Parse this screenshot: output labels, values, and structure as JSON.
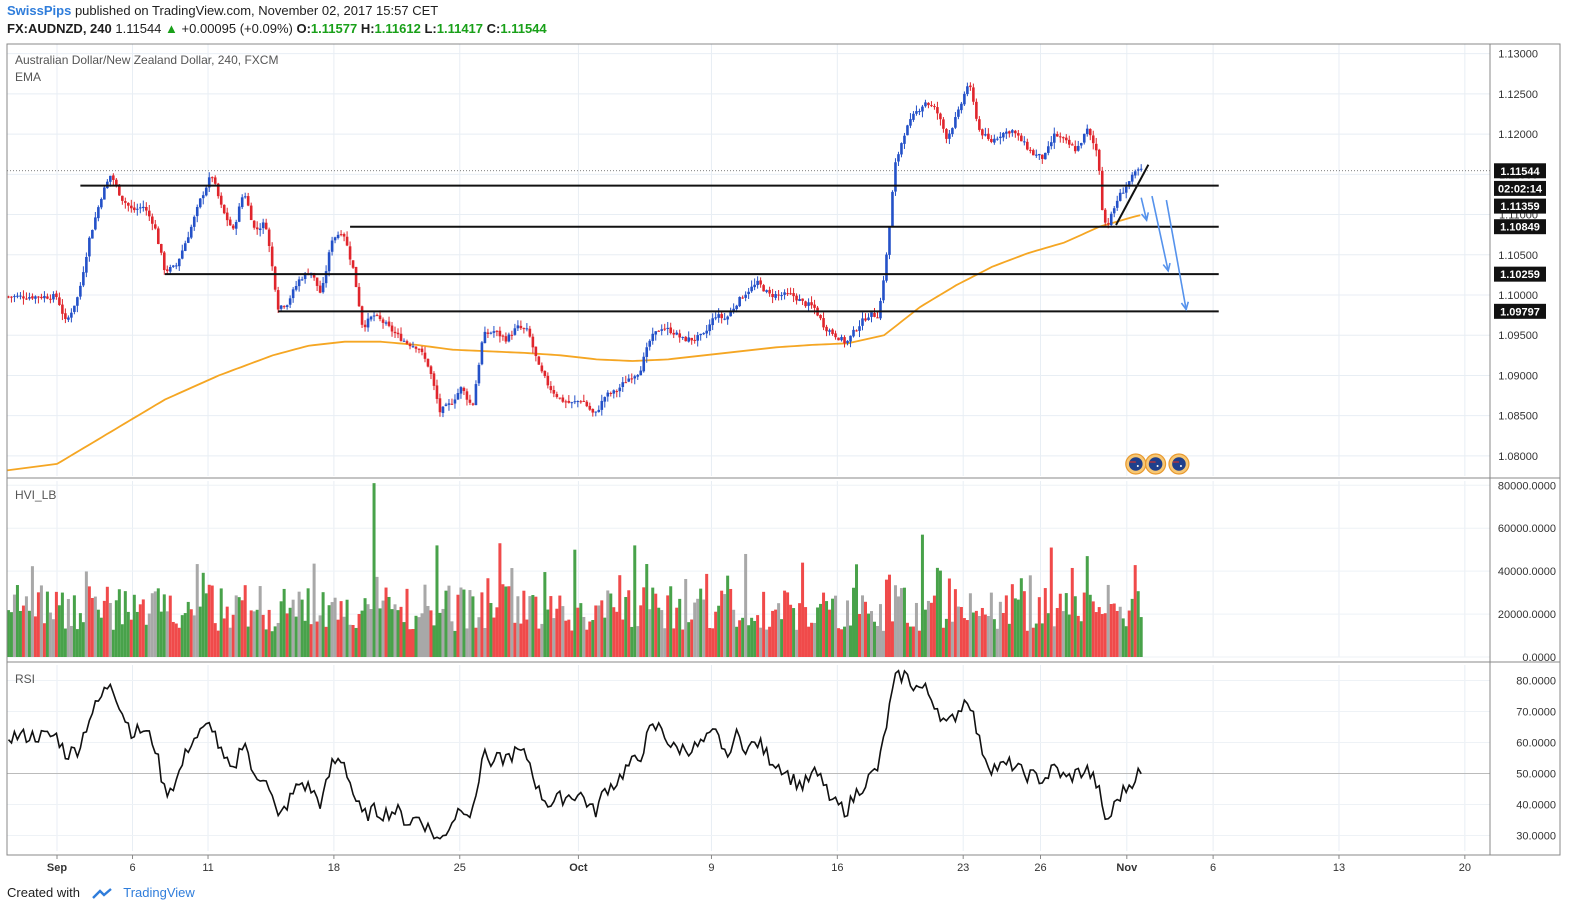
{
  "header": {
    "author": "SwissPips",
    "published": "published on TradingView.com, November 02, 2017 15:57 CET",
    "symbol": "FX:AUDNZD, 240",
    "last": "1.11544",
    "change": "+0.00095 (+0.09%)",
    "o_label": "O:",
    "o_value": "1.11577",
    "h_label": "H:",
    "h_value": "1.11612",
    "l_label": "L:",
    "l_value": "1.11417",
    "c_label": "C:",
    "c_value": "1.11544"
  },
  "footer": {
    "created": "Created with",
    "brand": "TradingView"
  },
  "colors": {
    "up": "#2451c8",
    "down": "#e0252c",
    "ema": "#f5a623",
    "vol_up": "#48a24a",
    "vol_down": "#f04a4a",
    "vol_neutral": "#a8a8a8",
    "arrow": "#5592ec"
  },
  "chart_data": [
    {
      "type": "candlestick",
      "title": "Australian Dollar/New Zealand Dollar, 240, FXCM",
      "subtitle": "EMA",
      "x_ticks": [
        "Sep",
        "6",
        "11",
        "18",
        "25",
        "Oct",
        "9",
        "16",
        "23",
        "26",
        "Nov",
        "6",
        "13",
        "20"
      ],
      "ylim": [
        1.0775,
        1.1312
      ],
      "y_ticks": [
        "1.13000",
        "1.12500",
        "1.12000",
        "1.11500",
        "1.11000",
        "1.10500",
        "1.10000",
        "1.09500",
        "1.09000",
        "1.08500",
        "1.08000"
      ],
      "price_labels": [
        {
          "text": "1.11544",
          "value": 1.11544
        },
        {
          "text": "02:02:14",
          "value": 1.11325
        },
        {
          "text": "1.11359",
          "value": 1.11105
        },
        {
          "text": "1.10849",
          "value": 1.10849
        },
        {
          "text": "1.10259",
          "value": 1.10259
        },
        {
          "text": "1.09797",
          "value": 1.09797
        }
      ],
      "horizontal_levels": [
        {
          "value": 1.11359,
          "from_day": 1.3,
          "to_day": 63.5
        },
        {
          "value": 1.10849,
          "from_day": 16.3,
          "to_day": 63.5
        },
        {
          "value": 1.10259,
          "from_day": 6.0,
          "to_day": 63.5
        },
        {
          "value": 1.09797,
          "from_day": 12.3,
          "to_day": 63.5
        }
      ],
      "close_path": [
        [
          0.0,
          1.0998
        ],
        [
          0.5,
          1.0965
        ],
        [
          1.2,
          1.1
        ],
        [
          1.8,
          1.107
        ],
        [
          2.5,
          1.1125
        ],
        [
          3.0,
          1.115
        ],
        [
          3.6,
          1.112
        ],
        [
          4.2,
          1.1105
        ],
        [
          4.8,
          1.111
        ],
        [
          5.4,
          1.1088
        ],
        [
          6.0,
          1.103
        ],
        [
          6.6,
          1.1035
        ],
        [
          7.4,
          1.108
        ],
        [
          8.0,
          1.112
        ],
        [
          8.6,
          1.115
        ],
        [
          9.2,
          1.1105
        ],
        [
          9.8,
          1.108
        ],
        [
          10.4,
          1.113
        ],
        [
          11.0,
          1.108
        ],
        [
          11.6,
          1.109
        ],
        [
          12.3,
          1.0985
        ],
        [
          12.8,
          1.099
        ],
        [
          13.5,
          1.102
        ],
        [
          14.1,
          1.103
        ],
        [
          14.7,
          1.1
        ],
        [
          15.3,
          1.107
        ],
        [
          15.9,
          1.108
        ],
        [
          16.5,
          1.103
        ],
        [
          17.0,
          1.096
        ],
        [
          17.6,
          1.0975
        ],
        [
          18.2,
          1.0965
        ],
        [
          18.9,
          1.095
        ],
        [
          19.5,
          1.094
        ],
        [
          20.1,
          1.0935
        ],
        [
          20.7,
          1.091
        ],
        [
          21.3,
          1.0855
        ],
        [
          21.9,
          1.0865
        ],
        [
          22.5,
          1.0885
        ],
        [
          23.1,
          1.086
        ],
        [
          23.7,
          1.095
        ],
        [
          24.3,
          1.0955
        ],
        [
          25.0,
          1.0945
        ],
        [
          25.6,
          1.096
        ],
        [
          26.2,
          1.0955
        ],
        [
          26.8,
          1.091
        ],
        [
          27.4,
          1.0885
        ],
        [
          28.0,
          1.087
        ],
        [
          28.6,
          1.0865
        ],
        [
          29.2,
          1.087
        ],
        [
          29.9,
          1.085
        ],
        [
          30.5,
          1.0875
        ],
        [
          31.1,
          1.088
        ],
        [
          31.7,
          1.0895
        ],
        [
          32.4,
          1.0905
        ],
        [
          33.0,
          1.0945
        ],
        [
          33.6,
          1.096
        ],
        [
          34.2,
          1.0955
        ],
        [
          34.8,
          1.0945
        ],
        [
          35.4,
          1.0945
        ],
        [
          36.0,
          1.095
        ],
        [
          36.6,
          1.0975
        ],
        [
          37.2,
          1.097
        ],
        [
          37.8,
          1.099
        ],
        [
          38.4,
          1.1005
        ],
        [
          39.0,
          1.1015
        ],
        [
          39.6,
          1.1
        ],
        [
          40.3,
          1.1
        ],
        [
          40.9,
          1.1
        ],
        [
          41.5,
          1.099
        ],
        [
          42.1,
          1.0985
        ],
        [
          42.7,
          1.096
        ],
        [
          43.3,
          1.095
        ],
        [
          43.9,
          1.094
        ],
        [
          44.5,
          1.096
        ],
        [
          45.1,
          1.0975
        ],
        [
          45.7,
          1.0975
        ],
        [
          46.2,
          1.106
        ],
        [
          46.6,
          1.116
        ],
        [
          47.1,
          1.12
        ],
        [
          47.7,
          1.1225
        ],
        [
          48.3,
          1.124
        ],
        [
          48.9,
          1.123
        ],
        [
          49.5,
          1.1195
        ],
        [
          50.1,
          1.1225
        ],
        [
          50.7,
          1.1265
        ],
        [
          51.3,
          1.1205
        ],
        [
          51.9,
          1.119
        ],
        [
          52.5,
          1.12
        ],
        [
          53.1,
          1.1205
        ],
        [
          53.7,
          1.119
        ],
        [
          54.3,
          1.1175
        ],
        [
          54.9,
          1.117
        ],
        [
          55.5,
          1.12
        ],
        [
          56.1,
          1.119
        ],
        [
          56.7,
          1.118
        ],
        [
          57.3,
          1.1205
        ],
        [
          57.9,
          1.1175
        ],
        [
          58.2,
          1.109
        ],
        [
          58.5,
          1.109
        ],
        [
          59.0,
          1.112
        ],
        [
          59.6,
          1.114
        ],
        [
          60.1,
          1.1155
        ],
        [
          60.4,
          1.1154
        ]
      ],
      "ema_path": [
        [
          0.0,
          1.079
        ],
        [
          3.0,
          1.083
        ],
        [
          6.0,
          1.087
        ],
        [
          9.0,
          1.09
        ],
        [
          12.0,
          1.0925
        ],
        [
          14.0,
          1.0937
        ],
        [
          16.0,
          1.0942
        ],
        [
          18.0,
          1.0942
        ],
        [
          20.0,
          1.0938
        ],
        [
          22.0,
          1.0932
        ],
        [
          24.0,
          1.093
        ],
        [
          26.0,
          1.0928
        ],
        [
          28.0,
          1.0925
        ],
        [
          30.0,
          1.092
        ],
        [
          32.0,
          1.0918
        ],
        [
          34.0,
          1.092
        ],
        [
          36.0,
          1.0925
        ],
        [
          38.0,
          1.093
        ],
        [
          40.0,
          1.0935
        ],
        [
          42.0,
          1.0938
        ],
        [
          44.0,
          1.094
        ],
        [
          46.0,
          1.095
        ],
        [
          48.0,
          1.0985
        ],
        [
          50.0,
          1.1012
        ],
        [
          52.0,
          1.1035
        ],
        [
          54.0,
          1.1052
        ],
        [
          56.0,
          1.1065
        ],
        [
          58.0,
          1.1085
        ],
        [
          60.0,
          1.1098
        ],
        [
          60.4,
          1.11
        ]
      ],
      "dotted_last_price": 1.11544,
      "forecast_arrows": [
        [
          [
            60.3,
            1.1121
          ],
          [
            60.6,
            1.1093
          ]
        ],
        [
          [
            60.9,
            1.1123
          ],
          [
            61.8,
            1.103
          ]
        ],
        [
          [
            61.7,
            1.1118
          ],
          [
            62.8,
            1.0982
          ]
        ]
      ],
      "trendline": [
        [
          58.9,
          1.1087
        ],
        [
          60.7,
          1.1162
        ]
      ],
      "event_markers": [
        {
          "day": 60.0
        },
        {
          "day": 61.1
        },
        {
          "day": 62.4
        }
      ]
    },
    {
      "type": "bar",
      "title": "HVI_LB",
      "ylim": [
        0,
        82000
      ],
      "y_ticks": [
        "80000.0000",
        "60000.0000",
        "40000.0000",
        "20000.0000",
        "0.0000"
      ],
      "spikes": [
        {
          "day": 17.7,
          "value": 81000
        },
        {
          "day": 21.2,
          "value": 52000
        },
        {
          "day": 24.6,
          "value": 53000
        },
        {
          "day": 28.9,
          "value": 50000
        },
        {
          "day": 32.2,
          "value": 52000
        },
        {
          "day": 38.3,
          "value": 48000
        },
        {
          "day": 48.2,
          "value": 57000
        },
        {
          "day": 55.4,
          "value": 51000
        },
        {
          "day": 57.3,
          "value": 47000
        }
      ]
    },
    {
      "type": "line",
      "title": "RSI",
      "ylim": [
        25,
        85
      ],
      "y_ticks": [
        "80.0000",
        "70.0000",
        "60.0000",
        "50.0000",
        "40.0000",
        "30.0000"
      ],
      "reference_line": 50,
      "values_path": [
        [
          0.0,
          62
        ],
        [
          0.5,
          56
        ],
        [
          1.2,
          58
        ],
        [
          1.8,
          68
        ],
        [
          2.5,
          75
        ],
        [
          3.0,
          80
        ],
        [
          3.6,
          70
        ],
        [
          4.2,
          63
        ],
        [
          4.8,
          64
        ],
        [
          5.4,
          60
        ],
        [
          6.0,
          44
        ],
        [
          6.6,
          47
        ],
        [
          7.4,
          60
        ],
        [
          8.0,
          63
        ],
        [
          8.6,
          66
        ],
        [
          9.2,
          55
        ],
        [
          9.8,
          50
        ],
        [
          10.4,
          62
        ],
        [
          11.0,
          47
        ],
        [
          11.6,
          50
        ],
        [
          12.3,
          35
        ],
        [
          12.8,
          40
        ],
        [
          13.5,
          47
        ],
        [
          14.1,
          45
        ],
        [
          14.7,
          40
        ],
        [
          15.3,
          53
        ],
        [
          15.9,
          55
        ],
        [
          16.5,
          43
        ],
        [
          17.0,
          36
        ],
        [
          17.6,
          38
        ],
        [
          18.2,
          37
        ],
        [
          18.9,
          38
        ],
        [
          19.5,
          34
        ],
        [
          20.1,
          36
        ],
        [
          20.7,
          32
        ],
        [
          21.3,
          28
        ],
        [
          21.9,
          34
        ],
        [
          22.5,
          40
        ],
        [
          23.1,
          36
        ],
        [
          23.7,
          57
        ],
        [
          24.3,
          54
        ],
        [
          25.0,
          55
        ],
        [
          25.6,
          57
        ],
        [
          26.2,
          55
        ],
        [
          26.8,
          44
        ],
        [
          27.4,
          40
        ],
        [
          28.0,
          42
        ],
        [
          28.6,
          43
        ],
        [
          29.2,
          43
        ],
        [
          29.9,
          37
        ],
        [
          30.5,
          45
        ],
        [
          31.1,
          47
        ],
        [
          31.7,
          52
        ],
        [
          32.4,
          55
        ],
        [
          33.0,
          64
        ],
        [
          33.6,
          65
        ],
        [
          34.2,
          58
        ],
        [
          34.8,
          58
        ],
        [
          35.4,
          58
        ],
        [
          36.0,
          60
        ],
        [
          36.6,
          63
        ],
        [
          37.2,
          57
        ],
        [
          37.8,
          62
        ],
        [
          38.4,
          58
        ],
        [
          39.0,
          60
        ],
        [
          39.6,
          55
        ],
        [
          40.3,
          52
        ],
        [
          40.9,
          48
        ],
        [
          41.5,
          46
        ],
        [
          42.1,
          50
        ],
        [
          42.7,
          47
        ],
        [
          43.3,
          40
        ],
        [
          43.9,
          38
        ],
        [
          44.5,
          44
        ],
        [
          45.1,
          48
        ],
        [
          45.7,
          52
        ],
        [
          46.2,
          68
        ],
        [
          46.6,
          80
        ],
        [
          47.1,
          82
        ],
        [
          47.7,
          78
        ],
        [
          48.3,
          77
        ],
        [
          48.9,
          72
        ],
        [
          49.5,
          65
        ],
        [
          50.1,
          70
        ],
        [
          50.7,
          75
        ],
        [
          51.3,
          60
        ],
        [
          51.9,
          52
        ],
        [
          52.5,
          52
        ],
        [
          53.1,
          53
        ],
        [
          53.7,
          50
        ],
        [
          54.3,
          49
        ],
        [
          54.9,
          48
        ],
        [
          55.5,
          52
        ],
        [
          56.1,
          48
        ],
        [
          56.7,
          50
        ],
        [
          57.3,
          51
        ],
        [
          57.9,
          46
        ],
        [
          58.2,
          36
        ],
        [
          58.5,
          35
        ],
        [
          59.0,
          42
        ],
        [
          59.6,
          46
        ],
        [
          60.1,
          50
        ],
        [
          60.4,
          49
        ]
      ]
    }
  ]
}
